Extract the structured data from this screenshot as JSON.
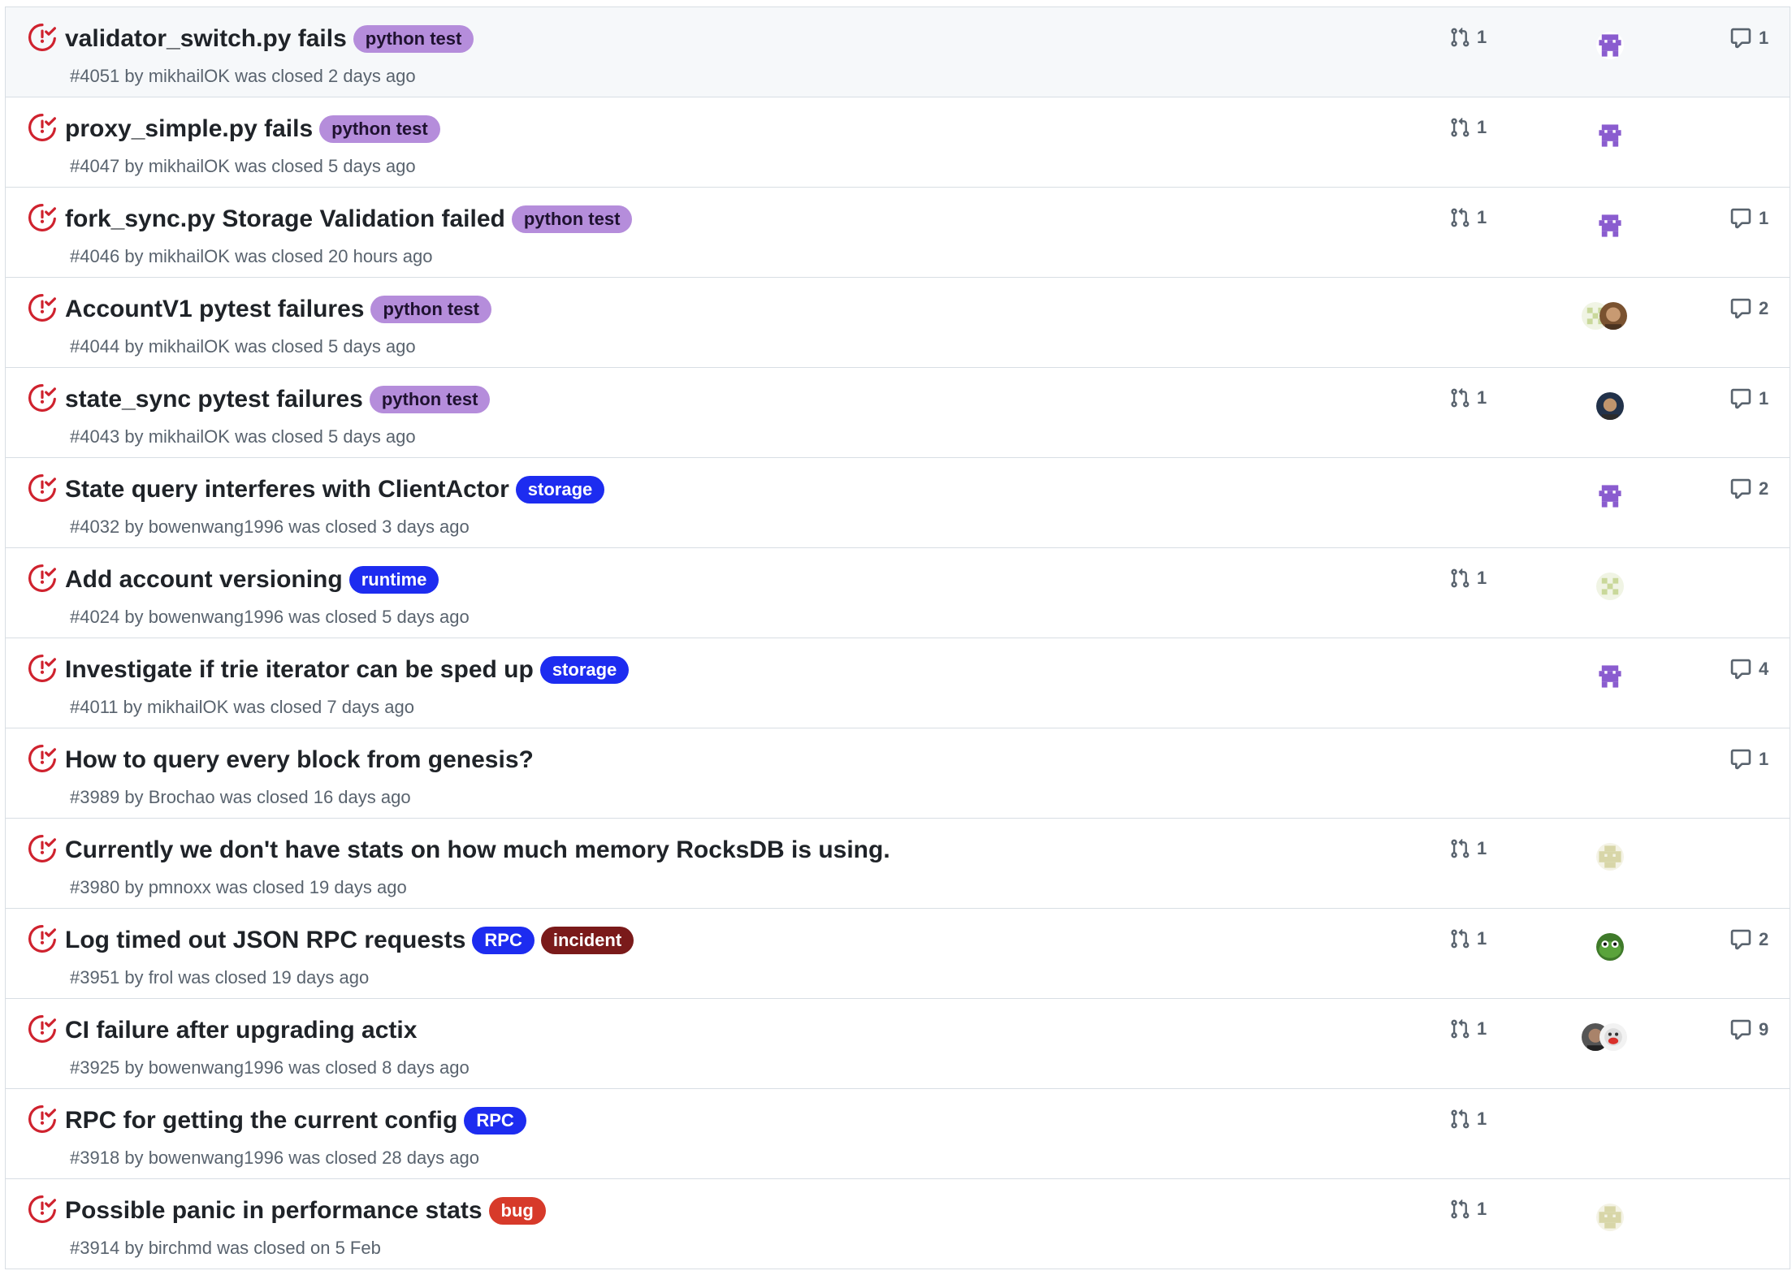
{
  "colors": {
    "closed_icon": "#cf222e",
    "python_test_bg": "#b58ddb",
    "python_test_fg": "#1f1230",
    "storage_bg": "#1d2cf0",
    "runtime_bg": "#1d2cf0",
    "rpc_bg": "#1d2cf0",
    "incident_bg": "#7a1a1a",
    "bug_bg": "#d73a2a"
  },
  "issues": [
    {
      "title": "validator_switch.py fails",
      "labels": [
        {
          "text": "python test",
          "type": "python"
        }
      ],
      "number": "#4051",
      "by": "by",
      "author": "mikhailOK",
      "closed_text": "was closed 2 days ago",
      "pr_count": "1",
      "assignees": [
        "purple-bot"
      ],
      "comments": "1"
    },
    {
      "title": "proxy_simple.py fails",
      "labels": [
        {
          "text": "python test",
          "type": "python"
        }
      ],
      "number": "#4047",
      "by": "by",
      "author": "mikhailOK",
      "closed_text": "was closed 5 days ago",
      "pr_count": "1",
      "assignees": [
        "purple-bot"
      ],
      "comments": ""
    },
    {
      "title": "fork_sync.py Storage Validation failed",
      "labels": [
        {
          "text": "python test",
          "type": "python"
        }
      ],
      "number": "#4046",
      "by": "by",
      "author": "mikhailOK",
      "closed_text": "was closed 20 hours ago",
      "pr_count": "1",
      "assignees": [
        "purple-bot"
      ],
      "comments": "1"
    },
    {
      "title": "AccountV1 pytest failures",
      "labels": [
        {
          "text": "python test",
          "type": "python"
        }
      ],
      "number": "#4044",
      "by": "by",
      "author": "mikhailOK",
      "closed_text": "was closed 5 days ago",
      "pr_count": "",
      "assignees": [
        "green-pixel",
        "photo-brown"
      ],
      "comments": "2"
    },
    {
      "title": "state_sync pytest failures",
      "labels": [
        {
          "text": "python test",
          "type": "python"
        }
      ],
      "number": "#4043",
      "by": "by",
      "author": "mikhailOK",
      "closed_text": "was closed 5 days ago",
      "pr_count": "1",
      "assignees": [
        "photo-dark"
      ],
      "comments": "1"
    },
    {
      "title": "State query interferes with ClientActor",
      "labels": [
        {
          "text": "storage",
          "type": "blue"
        }
      ],
      "number": "#4032",
      "by": "by",
      "author": "bowenwang1996",
      "closed_text": "was closed 3 days ago",
      "pr_count": "",
      "assignees": [
        "purple-bot"
      ],
      "comments": "2"
    },
    {
      "title": "Add account versioning",
      "labels": [
        {
          "text": "runtime",
          "type": "blue"
        }
      ],
      "number": "#4024",
      "by": "by",
      "author": "bowenwang1996",
      "closed_text": "was closed 5 days ago",
      "pr_count": "1",
      "assignees": [
        "green-pixel"
      ],
      "comments": ""
    },
    {
      "title": "Investigate if trie iterator can be sped up",
      "labels": [
        {
          "text": "storage",
          "type": "blue"
        }
      ],
      "number": "#4011",
      "by": "by",
      "author": "mikhailOK",
      "closed_text": "was closed 7 days ago",
      "pr_count": "",
      "assignees": [
        "purple-bot"
      ],
      "comments": "4"
    },
    {
      "title": "How to query every block from genesis?",
      "labels": [],
      "number": "#3989",
      "by": "by",
      "author": "Brochao",
      "closed_text": "was closed 16 days ago",
      "pr_count": "",
      "assignees": [],
      "comments": "1"
    },
    {
      "title": "Currently we don't have stats on how much memory RocksDB is using.",
      "labels": [],
      "number": "#3980",
      "by": "by",
      "author": "pmnoxx",
      "closed_text": "was closed 19 days ago",
      "pr_count": "1",
      "assignees": [
        "olive-pixel"
      ],
      "comments": ""
    },
    {
      "title": "Log timed out JSON RPC requests",
      "labels": [
        {
          "text": "RPC",
          "type": "blue"
        },
        {
          "text": "incident",
          "type": "incident"
        }
      ],
      "number": "#3951",
      "by": "by",
      "author": "frol",
      "closed_text": "was closed 19 days ago",
      "pr_count": "1",
      "assignees": [
        "frog"
      ],
      "comments": "2"
    },
    {
      "title": "CI failure after upgrading actix",
      "labels": [],
      "number": "#3925",
      "by": "by",
      "author": "bowenwang1996",
      "closed_text": "was closed 8 days ago",
      "pr_count": "1",
      "assignees": [
        "photo-gray",
        "cartoon"
      ],
      "comments": "9"
    },
    {
      "title": "RPC for getting the current config",
      "labels": [
        {
          "text": "RPC",
          "type": "blue"
        }
      ],
      "number": "#3918",
      "by": "by",
      "author": "bowenwang1996",
      "closed_text": "was closed 28 days ago",
      "pr_count": "1",
      "assignees": [],
      "comments": ""
    },
    {
      "title": "Possible panic in performance stats",
      "labels": [
        {
          "text": "bug",
          "type": "bug"
        }
      ],
      "number": "#3914",
      "by": "by",
      "author": "birchmd",
      "closed_text": "was closed on 5 Feb",
      "pr_count": "1",
      "assignees": [
        "olive-pixel"
      ],
      "comments": ""
    }
  ]
}
